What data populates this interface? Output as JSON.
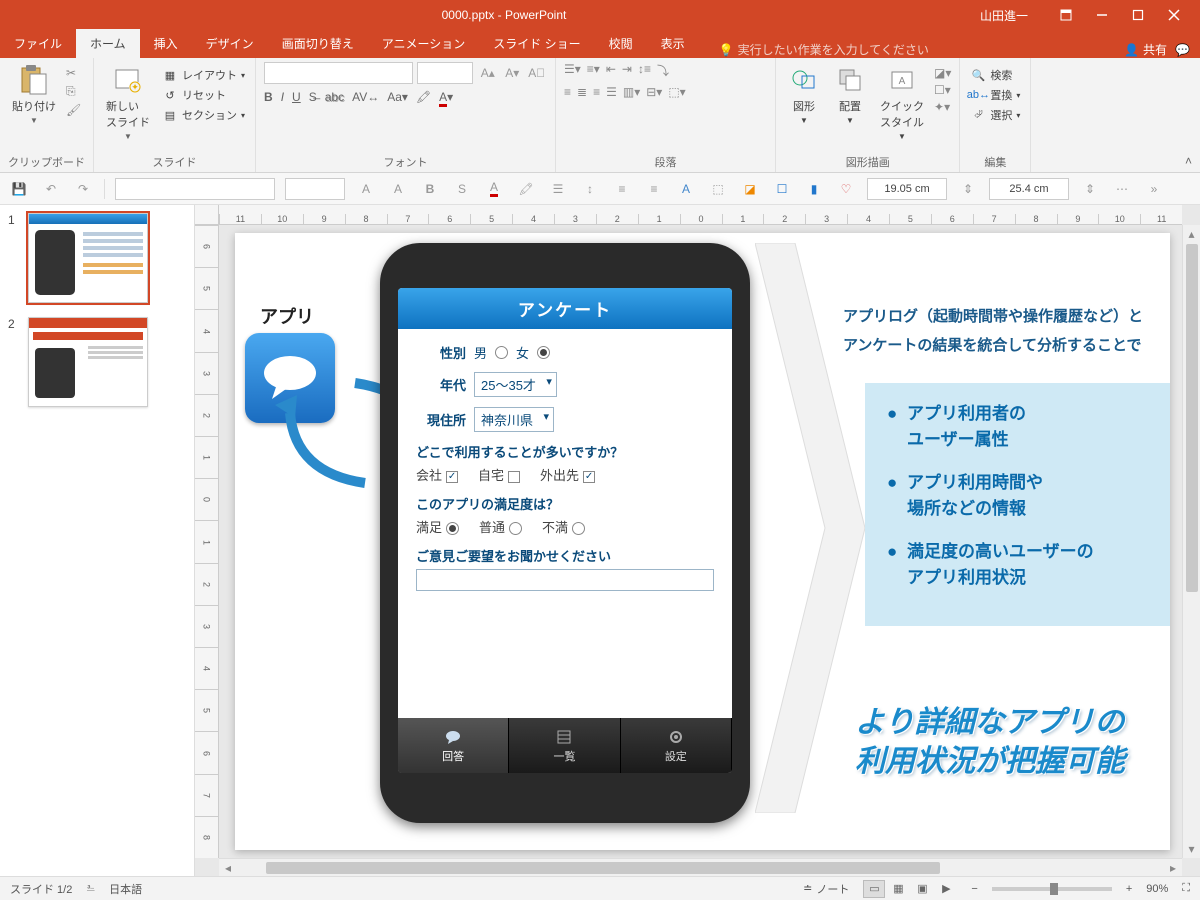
{
  "title": "0000.pptx  -  PowerPoint",
  "user": "山田進一",
  "tabs": {
    "file": "ファイル",
    "home": "ホーム",
    "insert": "挿入",
    "design": "デザイン",
    "transitions": "画面切り替え",
    "animations": "アニメーション",
    "slideshow": "スライド ショー",
    "review": "校閲",
    "view": "表示"
  },
  "tellme": "実行したい作業を入力してください",
  "share": "共有",
  "ribbon": {
    "clipboard": {
      "label": "クリップボード",
      "paste": "貼り付け"
    },
    "slides": {
      "label": "スライド",
      "newslide": "新しい\nスライド",
      "layout": "レイアウト",
      "reset": "リセット",
      "section": "セクション"
    },
    "font": {
      "label": "フォント"
    },
    "paragraph": {
      "label": "段落"
    },
    "drawing": {
      "label": "図形描画",
      "shapes": "図形",
      "arrange": "配置",
      "quick": "クイック\nスタイル"
    },
    "editing": {
      "label": "編集",
      "find": "検索",
      "replace": "置換",
      "select": "選択"
    }
  },
  "qat": {
    "dim1": "19.05 cm",
    "dim2": "25.4 cm"
  },
  "ruler_h": [
    "11",
    "10",
    "9",
    "8",
    "7",
    "6",
    "5",
    "4",
    "3",
    "2",
    "1",
    "0",
    "1",
    "2",
    "3",
    "4",
    "5",
    "6",
    "7",
    "8",
    "9",
    "10",
    "11"
  ],
  "ruler_v": [
    "6",
    "5",
    "4",
    "3",
    "2",
    "1",
    "0",
    "1",
    "2",
    "3",
    "4",
    "5",
    "6",
    "7",
    "8"
  ],
  "thumbs": {
    "n1": "1",
    "n2": "2"
  },
  "slide": {
    "app_label": "アプリ",
    "survey_header": "アンケート",
    "gender_label": "性別",
    "male": "男",
    "female": "女",
    "age_label": "年代",
    "age_value": "25～35才",
    "addr_label": "現住所",
    "addr_value": "神奈川県",
    "q1": "どこで利用することが多いですか？",
    "q1_a": "会社",
    "q1_b": "自宅",
    "q1_c": "外出先",
    "q2": "このアプリの満足度は？",
    "q2_a": "満足",
    "q2_b": "普通",
    "q2_c": "不満",
    "q3": "ご意見ご要望をお聞かせください",
    "tab_a": "回答",
    "tab_b": "一覧",
    "tab_c": "設定",
    "right1": "アプリログ（起動時間帯や操作履歴など）と",
    "right2": "アンケートの結果を統合して分析することで",
    "bullet1": "アプリ利用者の\nユーザー属性",
    "bullet2": "アプリ利用時間や\n場所などの情報",
    "bullet3": "満足度の高いユーザーの\nアプリ利用状況",
    "catch": "より詳細なアプリの\n利用状況が把握可能"
  },
  "status": {
    "slide": "スライド 1/2",
    "lang": "日本語",
    "notes": "ノート",
    "zoom": "90%"
  }
}
